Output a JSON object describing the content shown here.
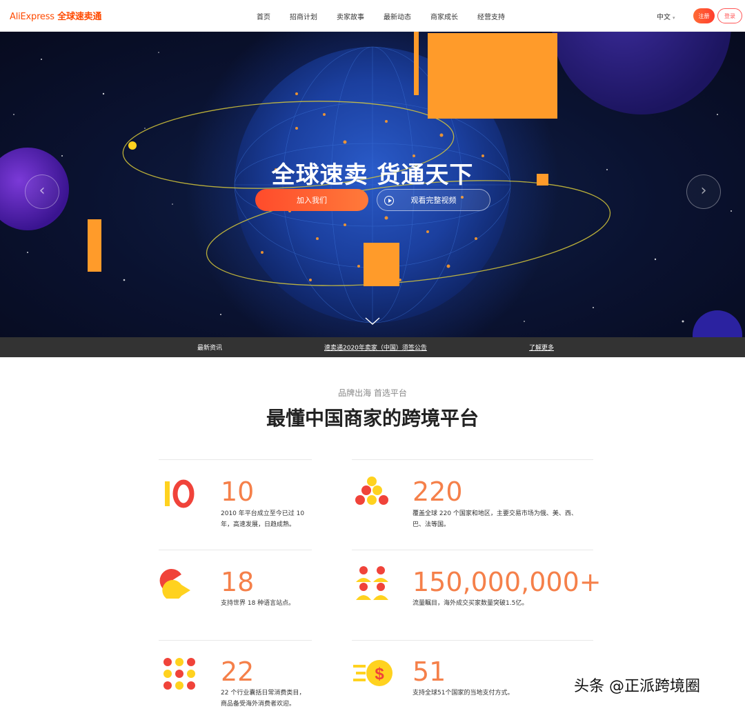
{
  "header": {
    "logo_brand": "AliExpress",
    "logo_cn": "全球速卖通",
    "nav": [
      "首页",
      "招商计划",
      "卖家故事",
      "最新动态",
      "商家成长",
      "经营支持"
    ],
    "lang": "中文",
    "register": "注册",
    "login": "登录"
  },
  "hero": {
    "title": "全球速卖 货通天下",
    "join_button": "加入我们",
    "video_button": "观看完整视频",
    "prev_icon": "chevron-left-icon",
    "next_icon": "chevron-right-icon",
    "scroll_icon": "chevron-down-icon"
  },
  "newsbar": {
    "label": "最新资讯",
    "headline": "速卖通2020年卖家（中国）须签公告",
    "more": "了解更多"
  },
  "section": {
    "subtitle": "品牌出海 首选平台",
    "title": "最懂中国商家的跨境平台"
  },
  "stats": [
    {
      "number": "10",
      "desc_lines": [
        "2010 年平台成立至今已过 10",
        "年，高速发展，日趋成熟。"
      ],
      "icon": "years-icon"
    },
    {
      "number": "220",
      "desc_lines": [
        "覆盖全球 220 个国家和地区，主要交易市场为俄、美、西、",
        "巴、法等国。"
      ],
      "icon": "countries-icon"
    },
    {
      "number": "18",
      "desc_lines": [
        "支持世界 18 种语言站点。"
      ],
      "icon": "languages-icon"
    },
    {
      "number": "150,000,000+",
      "desc_lines": [
        "流量瞩目，海外成交买家数量突破1.5亿。"
      ],
      "icon": "buyers-icon"
    },
    {
      "number": "22",
      "desc_lines": [
        "22 个行业囊括日常消费类目，",
        "商品备受海外消费者欢迎。"
      ],
      "icon": "industries-icon"
    },
    {
      "number": "51",
      "desc_lines": [
        "支持全球51个国家的当地支付方式。"
      ],
      "icon": "payment-icon"
    }
  ],
  "watermark": "头条 @正派跨境圈",
  "colors": {
    "accent": "#ff4a00",
    "stat": "#f5804a",
    "red": "#f0433a",
    "yellow": "#ffd21f",
    "orange_block": "#ff9b2a"
  }
}
